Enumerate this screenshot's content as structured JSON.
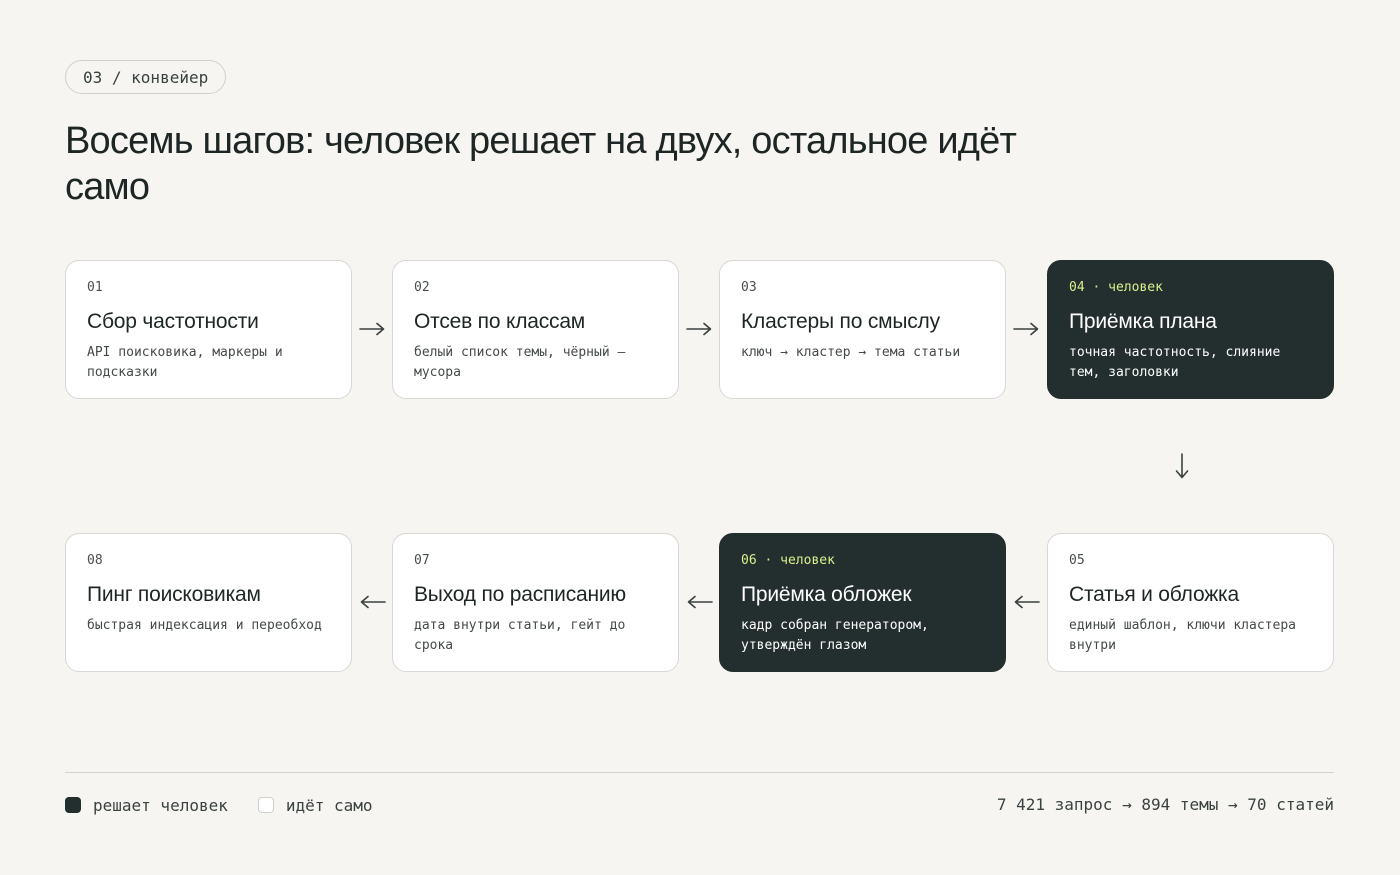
{
  "section_tag": "03 / конвейер",
  "title": "Восемь шагов: человек решает на двух, остальное идёт само",
  "steps": [
    {
      "num": "01",
      "title": "Сбор частотности",
      "desc": "API поисковика, маркеры и подсказки"
    },
    {
      "num": "02",
      "title": "Отсев по классам",
      "desc": "белый список темы, чёрный — мусора"
    },
    {
      "num": "03",
      "title": "Кластеры по смыслу",
      "desc": "ключ → кластер → тема статьи"
    },
    {
      "num": "04 · человек",
      "title": "Приёмка плана",
      "desc": "точная частотность, слияние тем, заголовки"
    },
    {
      "num": "05",
      "title": "Статья и обложка",
      "desc": "единый шаблон, ключи кластера внутри"
    },
    {
      "num": "06 · человек",
      "title": "Приёмка обложек",
      "desc": "кадр собран генератором, утверждён глазом"
    },
    {
      "num": "07",
      "title": "Выход по расписанию",
      "desc": "дата внутри статьи, гейт до срока"
    },
    {
      "num": "08",
      "title": "Пинг поисковикам",
      "desc": "быстрая индексация и переобход"
    }
  ],
  "legend": {
    "human": "решает человек",
    "auto": "идёт само"
  },
  "stats": "7 421 запрос → 894 темы → 70 статей",
  "colors": {
    "human_card": "#232e2e",
    "human_accent": "#d9f08f",
    "auto_card": "#ffffff",
    "background": "#f6f5f2"
  }
}
